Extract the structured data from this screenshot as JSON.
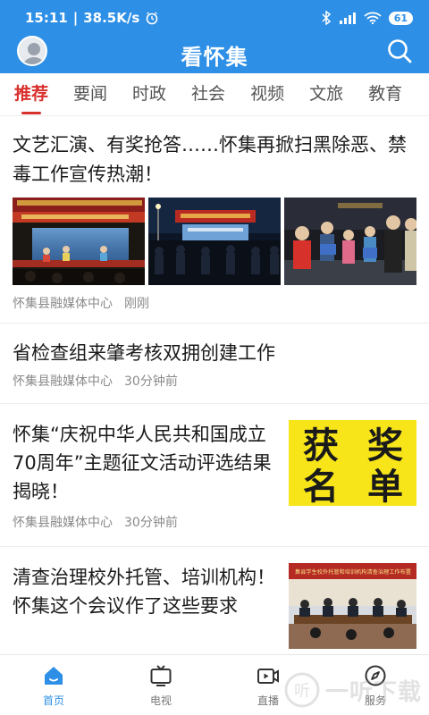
{
  "status_bar": {
    "time": "15:11",
    "speed": "38.5K/s",
    "battery": "61"
  },
  "app_bar": {
    "title": "看怀集"
  },
  "tabs": [
    {
      "label": "推荐",
      "active": true
    },
    {
      "label": "要闻"
    },
    {
      "label": "时政"
    },
    {
      "label": "社会"
    },
    {
      "label": "视频"
    },
    {
      "label": "文旅"
    },
    {
      "label": "教育"
    }
  ],
  "articles": [
    {
      "title": "文艺汇演、有奖抢答……怀集再掀扫黑除恶、禁毒工作宣传热潮！",
      "source": "怀集县融媒体中心",
      "time": "刚刚"
    },
    {
      "title": "省检查组来肇考核双拥创建工作",
      "source": "怀集县融媒体中心",
      "time": "30分钟前"
    },
    {
      "title": "怀集“庆祝中华人民共和国成立70周年”主题征文活动评选结果揭晓！",
      "source": "怀集县融媒体中心",
      "time": "30分钟前",
      "thumb_text": [
        "获",
        "奖",
        "名",
        "单"
      ]
    },
    {
      "title": "清查治理校外托管、培训机构！怀集这个会议作了这些要求",
      "thumb_banner": "集县学生校外托管和培训机构清查治理工作布置"
    }
  ],
  "bottom_nav": [
    {
      "label": "首页",
      "icon": "home-icon",
      "active": true
    },
    {
      "label": "电视",
      "icon": "tv-icon"
    },
    {
      "label": "直播",
      "icon": "live-video-icon"
    },
    {
      "label": "服务",
      "icon": "compass-icon"
    }
  ],
  "watermark": {
    "text": "一听下载"
  },
  "colors": {
    "brand_blue": "#2d8fe6",
    "active_red": "#d9302c"
  }
}
